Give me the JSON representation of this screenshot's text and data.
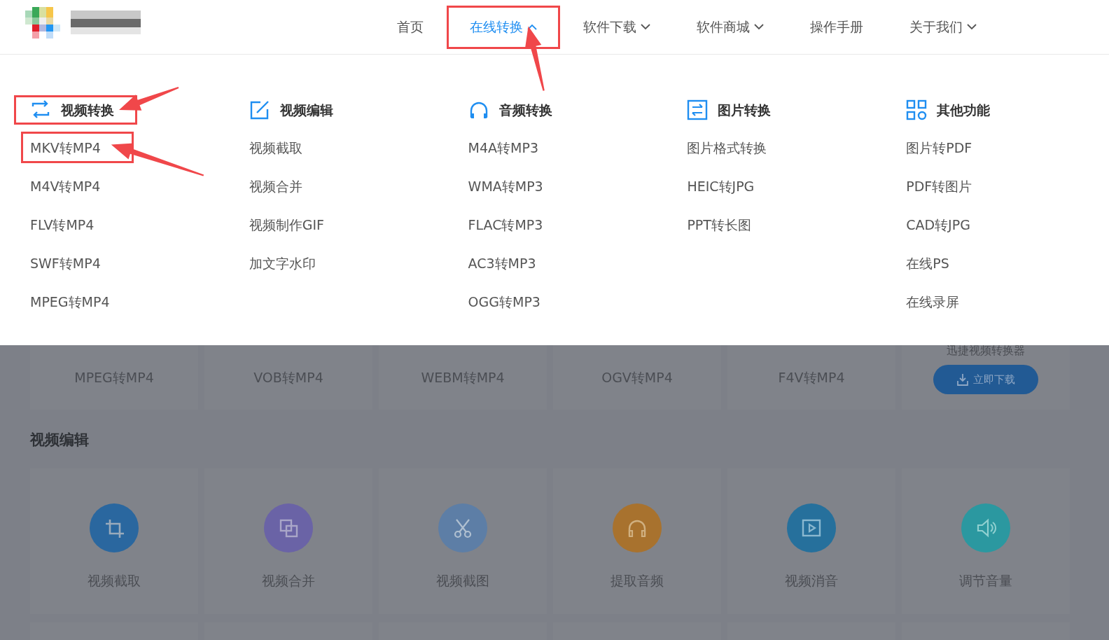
{
  "nav": [
    {
      "label": "首页",
      "selected": false,
      "highlighted": false
    },
    {
      "label": "在线转换",
      "expanded": true,
      "selected": true,
      "highlighted": true
    },
    {
      "label": "软件下载",
      "expanded": false,
      "selected": false,
      "highlighted": false
    },
    {
      "label": "软件商城",
      "expanded": false,
      "selected": false,
      "highlighted": false
    },
    {
      "label": "操作手册",
      "selected": false,
      "highlighted": false
    },
    {
      "label": "关于我们",
      "expanded": false,
      "selected": false,
      "highlighted": false
    }
  ],
  "menu": {
    "columns": [
      {
        "kind": "convert",
        "title": "视频转换",
        "highlighted": true,
        "items": [
          {
            "label": "MKV转MP4",
            "highlighted": true
          },
          {
            "label": "M4V转MP4",
            "highlighted": false
          },
          {
            "label": "FLV转MP4",
            "highlighted": false
          },
          {
            "label": "SWF转MP4",
            "highlighted": false
          },
          {
            "label": "MPEG转MP4",
            "highlighted": false
          }
        ]
      },
      {
        "kind": "edit",
        "title": "视频编辑",
        "highlighted": false,
        "items": [
          {
            "label": "视频截取",
            "highlighted": false
          },
          {
            "label": "视频合并",
            "highlighted": false
          },
          {
            "label": "视频制作GIF",
            "highlighted": false
          },
          {
            "label": "加文字水印",
            "highlighted": false
          }
        ]
      },
      {
        "kind": "headphones",
        "title": "音频转换",
        "highlighted": false,
        "items": [
          {
            "label": "M4A转MP3",
            "highlighted": false
          },
          {
            "label": "WMA转MP3",
            "highlighted": false
          },
          {
            "label": "FLAC转MP3",
            "highlighted": false
          },
          {
            "label": "AC3转MP3",
            "highlighted": false
          },
          {
            "label": "OGG转MP3",
            "highlighted": false
          }
        ]
      },
      {
        "kind": "swap",
        "title": "图片转换",
        "highlighted": false,
        "items": [
          {
            "label": "图片格式转换",
            "highlighted": false
          },
          {
            "label": "HEIC转JPG",
            "highlighted": false
          },
          {
            "label": "PPT转长图",
            "highlighted": false
          }
        ]
      },
      {
        "kind": "grid",
        "title": "其他功能",
        "highlighted": false,
        "items": [
          {
            "label": "图片转PDF",
            "highlighted": false
          },
          {
            "label": "PDF转图片",
            "highlighted": false
          },
          {
            "label": "CAD转JPG",
            "highlighted": false
          },
          {
            "label": "在线PS",
            "highlighted": false
          },
          {
            "label": "在线录屏",
            "highlighted": false
          }
        ]
      }
    ]
  },
  "background": {
    "format_cards": [
      "MPEG转MP4",
      "VOB转MP4",
      "WEBM转MP4",
      "OGV转MP4",
      "F4V转MP4"
    ],
    "promo": {
      "title": "迅捷视频转换器",
      "button": "立即下载"
    },
    "section_title": "视频编辑",
    "tools": [
      {
        "label": "视频截取",
        "kind": "crop",
        "color": "#2a679f"
      },
      {
        "label": "视频合并",
        "kind": "layers",
        "color": "#6a63a6"
      },
      {
        "label": "视频截图",
        "kind": "scissors",
        "color": "#5d7ea6"
      },
      {
        "label": "提取音频",
        "kind": "headphones",
        "color": "#a8722e"
      },
      {
        "label": "视频消音",
        "kind": "play",
        "color": "#26709c"
      },
      {
        "label": "调节音量",
        "kind": "volume",
        "color": "#2b98a0"
      }
    ]
  }
}
